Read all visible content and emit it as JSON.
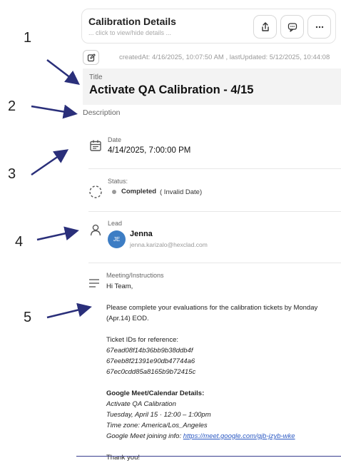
{
  "header": {
    "title": "Calibration Details",
    "subtitle": "... click to view/hide details ..."
  },
  "meta": {
    "text": "createdAt: 4/16/2025, 10:07:50 AM , lastUpdated: 5/12/2025, 10:44:08"
  },
  "title_field": {
    "label": "Title",
    "value": "Activate QA Calibration - 4/15"
  },
  "description_label": "Description",
  "date_field": {
    "label": "Date",
    "value": "4/14/2025, 7:00:00 PM"
  },
  "status_field": {
    "label": "Status:",
    "value": "Completed",
    "note": "( Invalid Date)"
  },
  "lead_field": {
    "label": "Lead",
    "initials": "JE",
    "name": "Jenna",
    "email": "jenna.karizalo@hexclad.com"
  },
  "instructions": {
    "label": "Meeting/Instructions",
    "greeting": "Hi Team,",
    "para1_line1": "Please complete your evaluations for the calibration tickets by Monday",
    "para1_line2": "(Apr.14) EOD.",
    "tickets_heading": "Ticket IDs for reference:",
    "ticket_ids": [
      "67ead08f14b36bb9b38ddb4f",
      "67eeb8f21391e90db47744a6",
      "67ec0cdd85a8165b9b72415c"
    ],
    "meet_heading": "Google Meet/Calendar Details:",
    "meet_name": "Activate QA Calibration",
    "meet_time": "Tuesday, April 15 · 12:00 – 1:00pm",
    "meet_tz": "Time zone: America/Los_Angeles",
    "meet_join_prefix": "Google Meet joining info: ",
    "meet_link": "https://meet.google.com/gjb-jzyb-wke",
    "closing": "Thank you!"
  },
  "annotations": [
    "1",
    "2",
    "3",
    "4",
    "5"
  ],
  "colors": {
    "avatar_bg": "#3d7dc4",
    "arrow": "#2a2f7a",
    "link": "#2b59c3"
  }
}
